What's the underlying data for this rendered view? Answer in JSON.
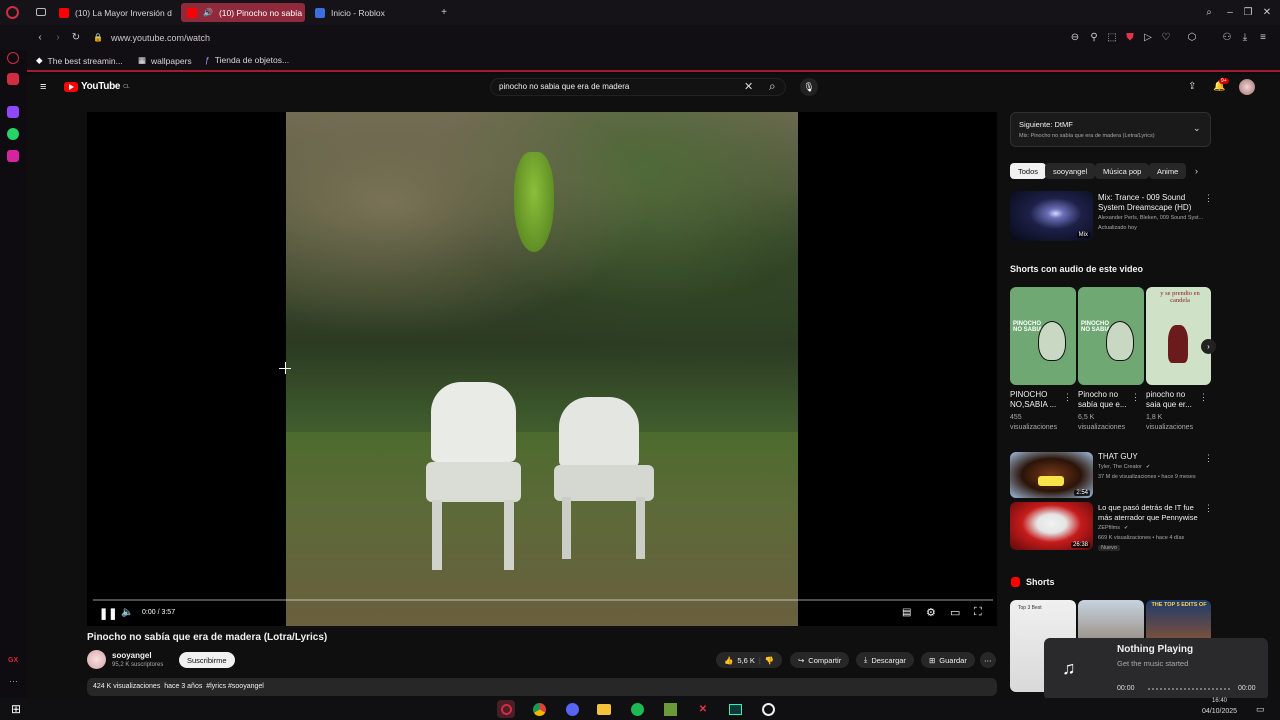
{
  "browser": {
    "tabs": [
      {
        "label": "(10) La Mayor Inversión d"
      },
      {
        "label": "(10) Pinocho no sabía"
      },
      {
        "label": "Inicio - Roblox"
      }
    ],
    "url": "www.youtube.com/watch",
    "bookmarks": [
      {
        "label": "The best streamin..."
      },
      {
        "label": "wallpapers"
      },
      {
        "label": "Tienda de objetos..."
      }
    ],
    "sidebar_bottom_label": "GX"
  },
  "youtube": {
    "logo": "YouTube",
    "logo_region": "CL",
    "search_value": "pinocho no sabia que era de madera",
    "notifications_badge": "9+",
    "player": {
      "time": "0:00 / 3:57",
      "progress": 0
    },
    "video": {
      "title": "Pinocho no sabía que era de madera (Lotra/Lyrics)",
      "channel": "sooyangel",
      "subscribers": "95,2 K suscriptores",
      "subscribe_label": "Suscribirme",
      "likes": "5,6 K",
      "share_label": "Compartir",
      "download_label": "Descargar",
      "save_label": "Guardar",
      "description": "424 K visualizaciones  hace 3 años  #lyrics #sooyangel"
    },
    "next_box": {
      "title": "Siguiente: DtMF",
      "subtitle": "Mix: Pinocho no sabía que era de madera (Letra/Lyrics)"
    },
    "chips": [
      "Todos",
      "sooyangel",
      "Música pop",
      "Anime"
    ],
    "mix": {
      "title": "Mix: Trance - 009 Sound System Dreamscape (HD)",
      "meta": "Alexander Perls, Bleken, 009 Sound Syst...",
      "updated": "Actualizado hoy",
      "badge": "Mix"
    },
    "shorts_audio_header": "Shorts con audio de este video",
    "shorts_audio": [
      {
        "thumb_text": "PINOCHO NO SABIA",
        "title": "PINOCHO NO,SABIA ...",
        "views": "455",
        "views_label": "visualizaciones"
      },
      {
        "thumb_text": "PINOCHO NO SABIA",
        "title": "Pinocho no sabía que e...",
        "views": "6,5 K",
        "views_label": "visualizaciones"
      },
      {
        "thumb_text": "y se prendio en candela",
        "title": "pinocho no saia que er...",
        "views": "1,8 K",
        "views_label": "visualizaciones"
      }
    ],
    "videos": [
      {
        "title": "THAT GUY",
        "channel": "Tyler, The Creator",
        "meta": "37 M de visualizaciones • hace 9 meses",
        "duration": "2:54"
      },
      {
        "title": "Lo que pasó detrás de IT fue más aterrador que Pennywise",
        "channel": "ZEPfilms",
        "meta": "669 K visualizaciones • hace 4 días",
        "duration": "26:38",
        "badge": "Nuevo"
      }
    ],
    "shorts_header": "Shorts",
    "shorts_thumb_texts": [
      "Top 3 Best",
      "",
      "THE TOP 5 EDITS OF"
    ]
  },
  "now_playing": {
    "title": "Nothing Playing",
    "subtitle": "Get the music started",
    "time_start": "00:00",
    "time_end": "00:00"
  },
  "taskbar": {
    "clock_time": "16:40",
    "clock_date": "04/10/2025"
  },
  "colors": {
    "accent": "#a31b33",
    "yt_red": "#ff0000",
    "yt_bg": "#0f0f0f"
  }
}
